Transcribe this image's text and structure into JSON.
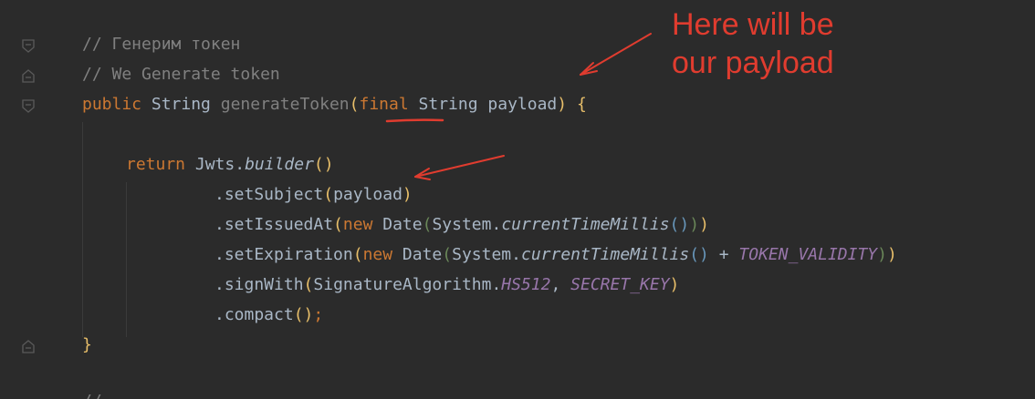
{
  "annotation": {
    "line1": "Here will be",
    "line2": "our payload"
  },
  "code": {
    "comment_ru": "// Генерим токен",
    "comment_en": "// We Generate token",
    "sig_public": "public",
    "sig_string": "String",
    "sig_method": "generateToken",
    "sig_paren_open": "(",
    "sig_final": "final",
    "sig_param_type": "String",
    "sig_param_name": "payload",
    "sig_paren_close": ")",
    "sig_brace": "{",
    "ret_keyword": "return",
    "ret_class": "Jwts.",
    "ret_method": "builder",
    "ret_parens": "()",
    "l_subject_name": ".setSubject",
    "l_subject_open": "(",
    "l_subject_arg": "payload",
    "l_subject_close": ")",
    "l_issued_name": ".setIssuedAt",
    "l_issued_open": "(",
    "l_issued_new": "new",
    "l_issued_date": "Date",
    "l_issued_open2": "(",
    "l_issued_sys": "System.",
    "l_issued_ctm": "currentTimeMillis",
    "l_issued_parens": "()",
    "l_issued_close2": ")",
    "l_issued_close": ")",
    "l_exp_name": ".setExpiration",
    "l_exp_open": "(",
    "l_exp_new": "new",
    "l_exp_date": "Date",
    "l_exp_open2": "(",
    "l_exp_sys": "System.",
    "l_exp_ctm": "currentTimeMillis",
    "l_exp_parens": "()",
    "l_exp_plus": " + ",
    "l_exp_const": "TOKEN_VALIDITY",
    "l_exp_close2": ")",
    "l_exp_close": ")",
    "l_sign_name": ".signWith",
    "l_sign_open": "(",
    "l_sign_class": "SignatureAlgorithm.",
    "l_sign_alg": "HS512",
    "l_sign_comma": ", ",
    "l_sign_key": "SECRET_KEY",
    "l_sign_close": ")",
    "l_compact_name": ".compact",
    "l_compact_parens": "()",
    "l_compact_semi": ";",
    "close_brace": "}",
    "next_line_fragment": "//"
  },
  "colors": {
    "background": "#2b2b2b",
    "keyword": "#cc7832",
    "comment": "#808080",
    "constant": "#9876aa",
    "annotation": "#e03c2f"
  }
}
